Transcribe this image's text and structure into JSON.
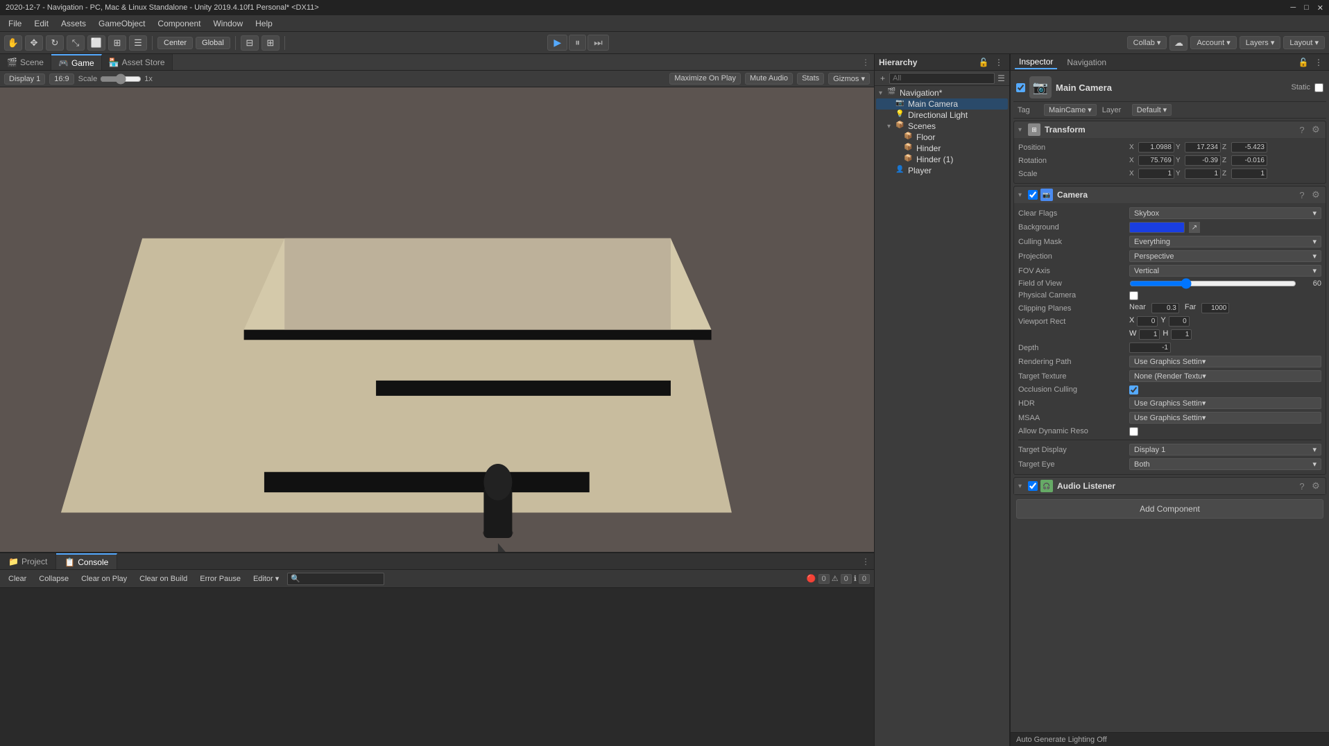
{
  "window": {
    "title": "2020-12-7 - Navigation - PC, Mac & Linux Standalone - Unity 2019.4.10f1 Personal* <DX11>"
  },
  "menubar": {
    "items": [
      "File",
      "Edit",
      "Assets",
      "GameObject",
      "Component",
      "Window",
      "Help"
    ]
  },
  "toolbar": {
    "center_label": "Center",
    "global_label": "Global",
    "collab_label": "Collab ▾",
    "account_label": "Account ▾",
    "layers_label": "Layers ▾",
    "layout_label": "Layout ▾"
  },
  "scene_tabs": {
    "scene_label": "Scene",
    "game_label": "Game",
    "asset_store_label": "Asset Store"
  },
  "game_toolbar": {
    "display_label": "Display 1",
    "aspect_label": "16:9",
    "scale_label": "Scale",
    "scale_value": "1x",
    "maximize_label": "Maximize On Play",
    "mute_label": "Mute Audio",
    "stats_label": "Stats",
    "gizmos_label": "Gizmos ▾"
  },
  "hierarchy": {
    "title": "Hierarchy",
    "search_placeholder": "All",
    "items": [
      {
        "label": "Navigation*",
        "depth": 0,
        "has_children": true,
        "type": "scene"
      },
      {
        "label": "Main Camera",
        "depth": 1,
        "has_children": false,
        "type": "go",
        "selected": true
      },
      {
        "label": "Directional Light",
        "depth": 1,
        "has_children": false,
        "type": "go"
      },
      {
        "label": "Scenes",
        "depth": 1,
        "has_children": true,
        "type": "go"
      },
      {
        "label": "Floor",
        "depth": 2,
        "has_children": false,
        "type": "go"
      },
      {
        "label": "Hinder",
        "depth": 2,
        "has_children": false,
        "type": "go"
      },
      {
        "label": "Hinder (1)",
        "depth": 2,
        "has_children": false,
        "type": "go"
      },
      {
        "label": "Player",
        "depth": 1,
        "has_children": false,
        "type": "go"
      }
    ]
  },
  "inspector": {
    "title": "Inspector",
    "navigation_tab": "Navigation",
    "gameobject_name": "Main Camera",
    "static_label": "Static",
    "tag_label": "Tag",
    "tag_value": "MainCame ▾",
    "layer_label": "Layer",
    "layer_value": "Default ▾",
    "transform": {
      "title": "Transform",
      "position_label": "Position",
      "pos_x": "1.0988",
      "pos_y": "17.234",
      "pos_z": "-5.423",
      "rotation_label": "Rotation",
      "rot_x": "75.769",
      "rot_y": "-0.39",
      "rot_z": "-0.016",
      "scale_label": "Scale",
      "scale_x": "1",
      "scale_y": "1",
      "scale_z": "1"
    },
    "camera": {
      "title": "Camera",
      "clear_flags_label": "Clear Flags",
      "clear_flags_value": "Skybox",
      "background_label": "Background",
      "culling_mask_label": "Culling Mask",
      "culling_mask_value": "Everything",
      "projection_label": "Projection",
      "projection_value": "Perspective",
      "fov_axis_label": "FOV Axis",
      "fov_axis_value": "Vertical",
      "fov_label": "Field of View",
      "fov_value": "60",
      "physical_camera_label": "Physical Camera",
      "clipping_label": "Clipping Planes",
      "near_label": "Near",
      "near_value": "0.3",
      "far_label": "Far",
      "far_value": "1000",
      "viewport_rect_label": "Viewport Rect",
      "vp_x_label": "X",
      "vp_x_value": "0",
      "vp_y_label": "Y",
      "vp_y_value": "0",
      "vp_w_label": "W",
      "vp_w_value": "1",
      "vp_h_label": "H",
      "vp_h_value": "1",
      "depth_label": "Depth",
      "depth_value": "-1",
      "rendering_path_label": "Rendering Path",
      "rendering_path_value": "Use Graphics Settin▾",
      "target_texture_label": "Target Texture",
      "target_texture_value": "None (Render Textu▾",
      "occlusion_label": "Occlusion Culling",
      "hdr_label": "HDR",
      "hdr_value": "Use Graphics Settin▾",
      "msaa_label": "MSAA",
      "msaa_value": "Use Graphics Settin▾",
      "allow_dynamic_label": "Allow Dynamic Reso",
      "target_display_label": "Target Display",
      "target_display_value": "Display 1",
      "target_eye_label": "Target Eye",
      "target_eye_value": "Both"
    },
    "audio_listener": {
      "title": "Audio Listener"
    },
    "add_component_label": "Add Component"
  },
  "bottom": {
    "project_tab": "Project",
    "console_tab": "Console",
    "clear_btn": "Clear",
    "collapse_btn": "Collapse",
    "clear_on_play_btn": "Clear on Play",
    "clear_on_build_btn": "Clear on Build",
    "error_pause_btn": "Error Pause",
    "editor_btn": "Editor ▾",
    "error_count": "0",
    "warning_count": "0",
    "info_count": "0"
  },
  "statusbar": {
    "text": "Auto Generate Lighting Off"
  }
}
